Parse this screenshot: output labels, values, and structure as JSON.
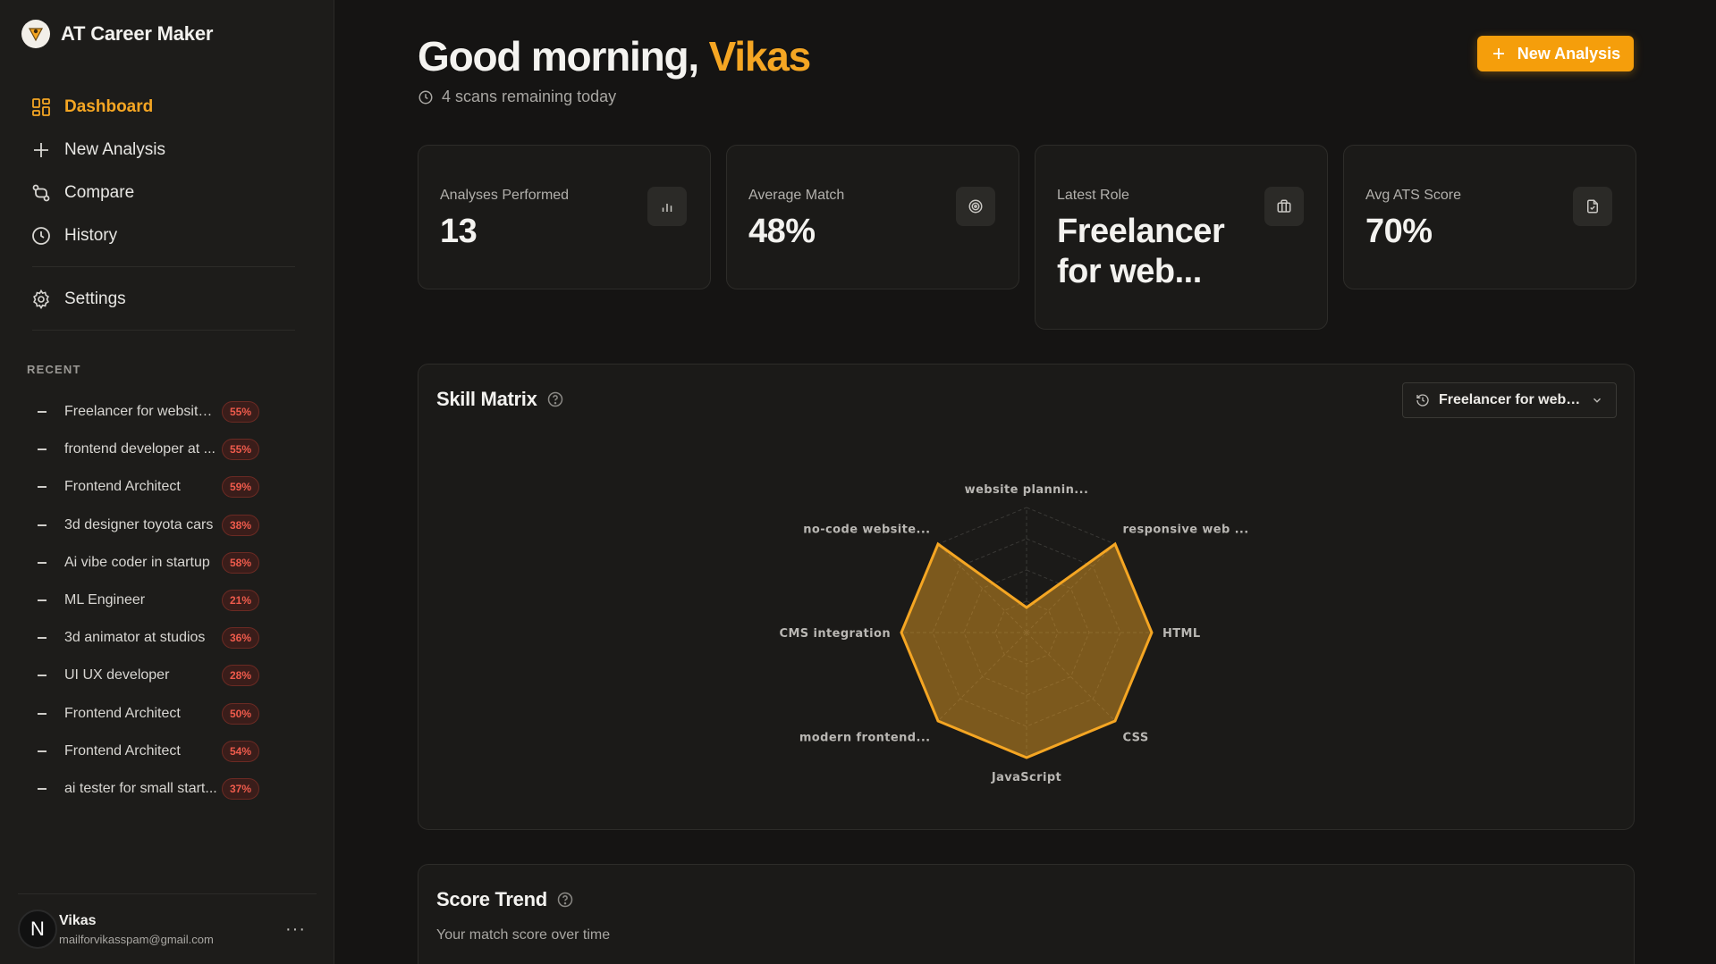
{
  "brand": {
    "name": "AT Career Maker"
  },
  "nav": [
    {
      "label": "Dashboard",
      "icon": "dashboard-icon",
      "active": true
    },
    {
      "label": "New Analysis",
      "icon": "plus-icon"
    },
    {
      "label": "Compare",
      "icon": "compare-icon"
    },
    {
      "label": "History",
      "icon": "clock-icon"
    },
    {
      "label": "Settings",
      "icon": "gear-icon"
    }
  ],
  "recent": {
    "title": "RECENT",
    "items": [
      {
        "label": "Freelancer for website ...",
        "score": "55%"
      },
      {
        "label": "frontend developer at ...",
        "score": "55%"
      },
      {
        "label": "Frontend Architect",
        "score": "59%"
      },
      {
        "label": "3d designer toyota cars",
        "score": "38%"
      },
      {
        "label": "Ai vibe coder in startup",
        "score": "58%"
      },
      {
        "label": "ML Engineer",
        "score": "21%"
      },
      {
        "label": "3d animator at studios",
        "score": "36%"
      },
      {
        "label": "UI UX developer",
        "score": "28%"
      },
      {
        "label": "Frontend Architect",
        "score": "50%"
      },
      {
        "label": "Frontend Architect",
        "score": "54%"
      },
      {
        "label": "ai tester for small start...",
        "score": "37%"
      }
    ]
  },
  "user": {
    "avatar": "N",
    "name": "Vikas",
    "email": "mailforvikasspam@gmail.com",
    "more": "···"
  },
  "header": {
    "greeting": "Good morning,",
    "name": "Vikas",
    "scans": "4 scans remaining today",
    "new_button": "New Analysis"
  },
  "stats": [
    {
      "label": "Analyses Performed",
      "value": "13",
      "icon": "bar-chart-icon"
    },
    {
      "label": "Average Match",
      "value": "48%",
      "icon": "target-icon"
    },
    {
      "label": "Latest Role",
      "value": "Freelancer for web...",
      "icon": "briefcase-icon"
    },
    {
      "label": "Avg ATS Score",
      "value": "70%",
      "icon": "document-check-icon"
    }
  ],
  "skill_matrix": {
    "title": "Skill Matrix",
    "selector": "Freelancer for websi..."
  },
  "score_trend": {
    "title": "Score Trend",
    "subtitle": "Your match score over time"
  },
  "colors": {
    "accent": "#f5a623",
    "badge": "#ef5b4c",
    "background": "#151413",
    "sidebar": "#1d1c1a"
  },
  "chart_data": {
    "type": "radar",
    "title": "Skill Matrix",
    "axes": [
      "website plannin...",
      "responsive web ...",
      "HTML",
      "CSS",
      "JavaScript",
      "modern frontend...",
      "CMS integration",
      "no-code website..."
    ],
    "values": [
      20,
      100,
      100,
      100,
      100,
      100,
      100,
      100
    ],
    "range": [
      0,
      100
    ]
  }
}
